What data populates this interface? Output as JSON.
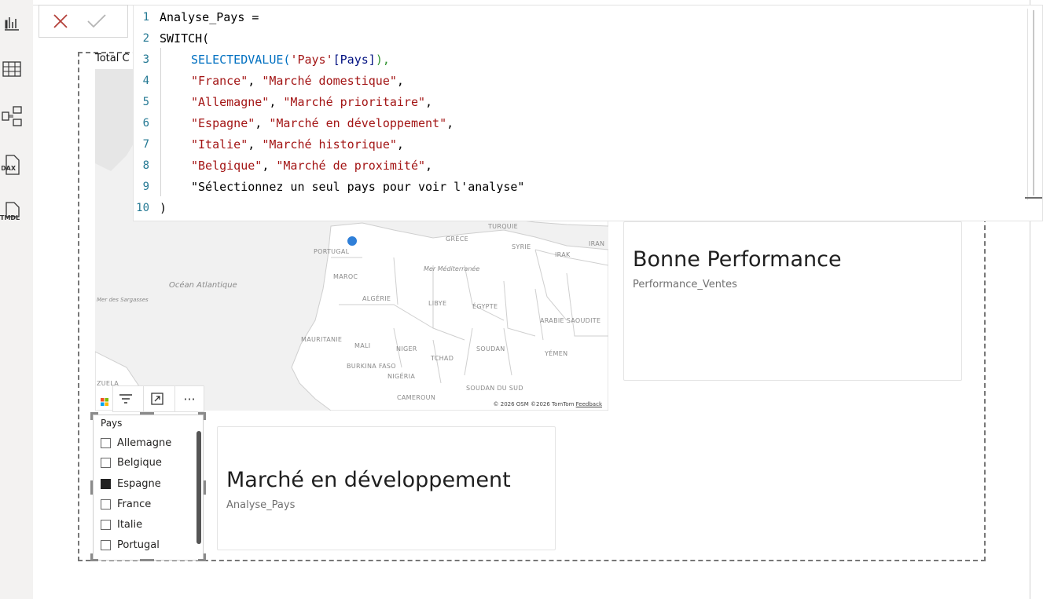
{
  "rail": {
    "icons": [
      "report-view-icon",
      "table-view-icon",
      "model-view-icon",
      "dax-query-view-icon",
      "tmdl-view-icon"
    ],
    "dax_label": "DAX",
    "tmdl_label": "TMDL"
  },
  "formula_bar": {
    "lines": [
      {
        "n": "1"
      },
      {
        "n": "2"
      },
      {
        "n": "3"
      },
      {
        "n": "4"
      },
      {
        "n": "5"
      },
      {
        "n": "6"
      },
      {
        "n": "7"
      },
      {
        "n": "8"
      },
      {
        "n": "9"
      },
      {
        "n": "10"
      }
    ],
    "l1": "Analyse_Pays =",
    "l2_fn": "SWITCH(",
    "l3_fn": "SELECTEDVALUE(",
    "l3_tbl": "'Pays'",
    "l3_col": "[Pays]",
    "l3_close": "),",
    "l4_a": "\"France\"",
    "l4_b": "\"Marché domestique\"",
    "l5_a": "\"Allemagne\"",
    "l5_b": "\"Marché prioritaire\"",
    "l6_a": "\"Espagne\"",
    "l6_b": "\"Marché en développement\"",
    "l7_a": "\"Italie\"",
    "l7_b": "\"Marché historique\"",
    "l8_a": "\"Belgique\"",
    "l8_b": "\"Marché de proximité\"",
    "l9": "\"Sélectionnez un seul pays pour voir l'analyse\"",
    "l10": ")"
  },
  "map": {
    "partial_title": "Total C",
    "ocean_label": "Océan Atlantique",
    "sargasso_label": "Mer des Sargasses",
    "med_label": "Mer Méditerranée",
    "countries": [
      "PORTUGAL",
      "MAROC",
      "ALGÉRIE",
      "LIBYE",
      "ÉGYPTE",
      "MAURITANIE",
      "MALI",
      "NIGER",
      "TCHAD",
      "SOUDAN",
      "BURKINA FASO",
      "NIGÉRIA",
      "CAMEROUN",
      "SOUDAN DU SUD",
      "ARABIE SAOUDITE",
      "YÉMEN",
      "GRÈCE",
      "TURQUIE",
      "SYRIE",
      "IRAK",
      "IRAN",
      "ZUELA"
    ],
    "attribution": "© 2026 OSM  ©2026 TomTom ",
    "feedback": "Feedback"
  },
  "card_performance": {
    "value": "Bonne Performance",
    "caption": "Performance_Ventes"
  },
  "card_analyse": {
    "value": "Marché en développement",
    "caption": "Analyse_Pays"
  },
  "slicer": {
    "title": "Pays",
    "items": [
      {
        "label": "Allemagne",
        "checked": false
      },
      {
        "label": "Belgique",
        "checked": false
      },
      {
        "label": "Espagne",
        "checked": true
      },
      {
        "label": "France",
        "checked": false
      },
      {
        "label": "Italie",
        "checked": false
      },
      {
        "label": "Portugal",
        "checked": false
      }
    ]
  },
  "visual_header": {
    "more_label": "···"
  }
}
